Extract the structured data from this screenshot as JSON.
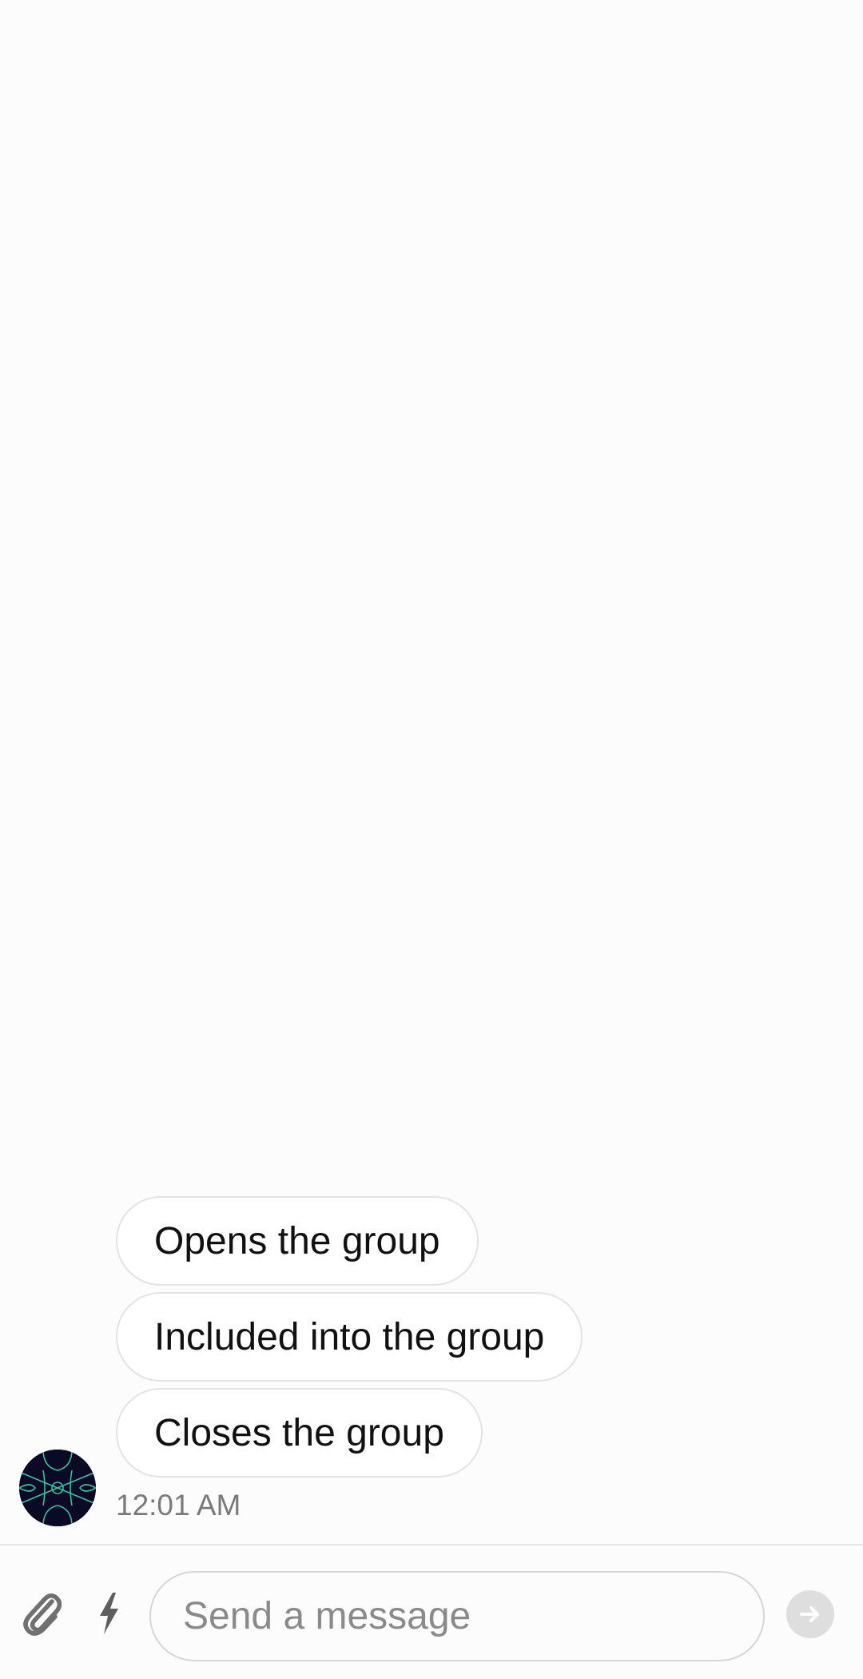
{
  "messages": {
    "quick_replies": [
      {
        "label": "Opens the group"
      },
      {
        "label": "Included into the group"
      },
      {
        "label": "Closes the group"
      }
    ],
    "timestamp": "12:01 AM",
    "avatar_icon": "bot-avatar-pattern"
  },
  "composer": {
    "attach_icon": "paperclip-icon",
    "quick_actions_icon": "lightning-bolt-icon",
    "input_placeholder": "Send a message",
    "input_value": "",
    "send_icon": "arrow-right-icon"
  },
  "colors": {
    "background": "#fcfcfc",
    "bubble_border": "#e3e3e3",
    "avatar_bg": "#0b0a26",
    "avatar_pattern": "#3fbfa0",
    "send_button_disabled": "#dedede",
    "timestamp_text": "#7a7a7a"
  }
}
